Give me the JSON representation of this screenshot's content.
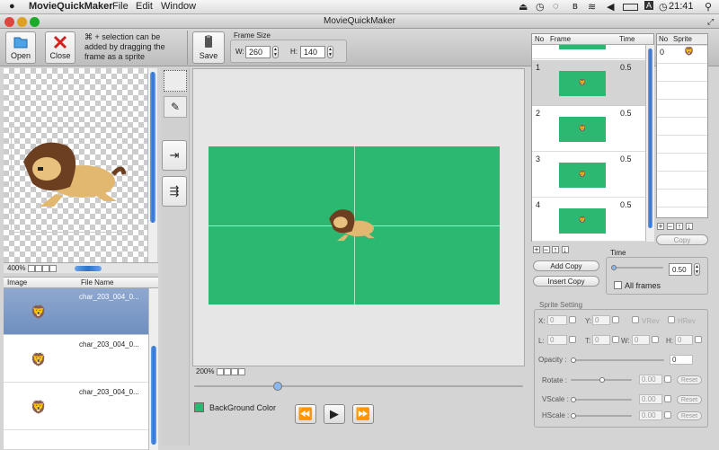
{
  "menubar": {
    "app": "MovieQuickMaker",
    "items": [
      "File",
      "Edit",
      "Window"
    ],
    "clock": "21:41",
    "input": "A"
  },
  "window": {
    "title": "MovieQuickMaker"
  },
  "toolbar": {
    "open_label": "Open",
    "close_label": "Close",
    "hint": "⌘ + selection can be added by dragging the frame as a sprite",
    "save_label": "Save",
    "frame_size_label": "Frame Size",
    "w_label": "W:",
    "w_value": "260",
    "h_label": "H:",
    "h_value": "140"
  },
  "preview": {
    "zoom": "400%"
  },
  "image_list": {
    "headers": [
      "Image",
      "File Name"
    ],
    "rows": [
      {
        "file": "char_203_004_0..."
      },
      {
        "file": "char_203_004_0..."
      },
      {
        "file": "char_203_004_0..."
      }
    ]
  },
  "canvas": {
    "zoom": "200%",
    "bg_label": "BackGround Color",
    "bg_color": "#2db871"
  },
  "frames": {
    "headers": [
      "No",
      "Frame",
      "Time"
    ],
    "rows": [
      {
        "no": "1",
        "time": "0.5"
      },
      {
        "no": "2",
        "time": "0.5"
      },
      {
        "no": "3",
        "time": "0.5"
      },
      {
        "no": "4",
        "time": "0.5"
      }
    ]
  },
  "sprites": {
    "headers": [
      "No",
      "Sprite"
    ],
    "rows": [
      {
        "no": "0"
      }
    ],
    "copy_label": "Copy"
  },
  "time": {
    "label": "Time",
    "value": "0.50",
    "all_frames": "All frames",
    "add_copy": "Add Copy",
    "insert_copy": "Insert Copy"
  },
  "sprite_setting": {
    "title": "Sprite Setting",
    "x": "X:",
    "x_val": "0",
    "y": "Y:",
    "y_val": "0",
    "vrev": "VRev",
    "hrev": "HRev",
    "l": "L:",
    "l_val": "0",
    "t": "T:",
    "t_val": "0",
    "w": "W:",
    "w_val": "0",
    "h": "H:",
    "h_val": "0",
    "opacity_label": "Opacity :",
    "opacity_val": "0",
    "rotate_label": "Rotate :",
    "rotate_val": "0.00",
    "vscale_label": "VScale :",
    "vscale_val": "0.00",
    "hscale_label": "HScale :",
    "hscale_val": "0.00",
    "reset": "Reset"
  }
}
